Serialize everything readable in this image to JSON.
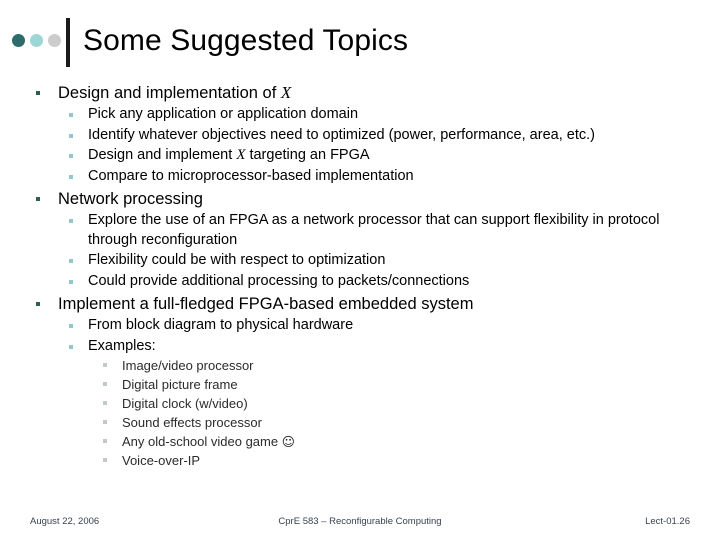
{
  "slide": {
    "title": "Some Suggested Topics",
    "decor_dot_colors": [
      "#2e6b6b",
      "#9ed6d6",
      "#cccccc"
    ],
    "title_bar_color": "#1a1a1a"
  },
  "bullet_colors": {
    "level1": "#2b5f52",
    "level2": "#8fc9cf",
    "level3": "#bfcacb"
  },
  "content": {
    "topic1": {
      "heading_pre": "Design and implementation of ",
      "heading_var": "X",
      "heading_post": "",
      "subs": [
        {
          "pre": "Pick any application or application domain",
          "var": "",
          "post": ""
        },
        {
          "pre": "Identify whatever objectives need to optimized (power, performance, area, etc.)",
          "var": "",
          "post": ""
        },
        {
          "pre": "Design and implement ",
          "var": "X",
          "post": " targeting an FPGA"
        },
        {
          "pre": "Compare to microprocessor-based implementation",
          "var": "",
          "post": ""
        }
      ]
    },
    "topic2": {
      "heading_pre": "Network processing",
      "heading_var": "",
      "heading_post": "",
      "subs": [
        {
          "pre": "Explore the use of an FPGA as a network processor that can support flexibility in protocol through reconfiguration",
          "var": "",
          "post": ""
        },
        {
          "pre": "Flexibility could be with respect to optimization",
          "var": "",
          "post": ""
        },
        {
          "pre": "Could provide additional processing to packets/connections",
          "var": "",
          "post": ""
        }
      ]
    },
    "topic3": {
      "heading_pre": "Implement a full-fledged FPGA-based embedded system",
      "heading_var": "",
      "heading_post": "",
      "subs": [
        {
          "pre": "From block diagram to physical hardware",
          "var": "",
          "post": ""
        },
        {
          "pre": "Examples:",
          "var": "",
          "post": ""
        }
      ],
      "examples": [
        {
          "pre": "Image/video processor",
          "smiley": ""
        },
        {
          "pre": "Digital picture frame",
          "smiley": ""
        },
        {
          "pre": "Digital clock (w/video)",
          "smiley": ""
        },
        {
          "pre": "Sound effects processor",
          "smiley": ""
        },
        {
          "pre": "Any old-school video game ",
          "smiley": "☺"
        },
        {
          "pre": "Voice-over-IP",
          "smiley": ""
        }
      ]
    }
  },
  "footer": {
    "date": "August 22, 2006",
    "course": "CprE 583 – Reconfigurable Computing",
    "lecture": "Lect-01.26"
  }
}
